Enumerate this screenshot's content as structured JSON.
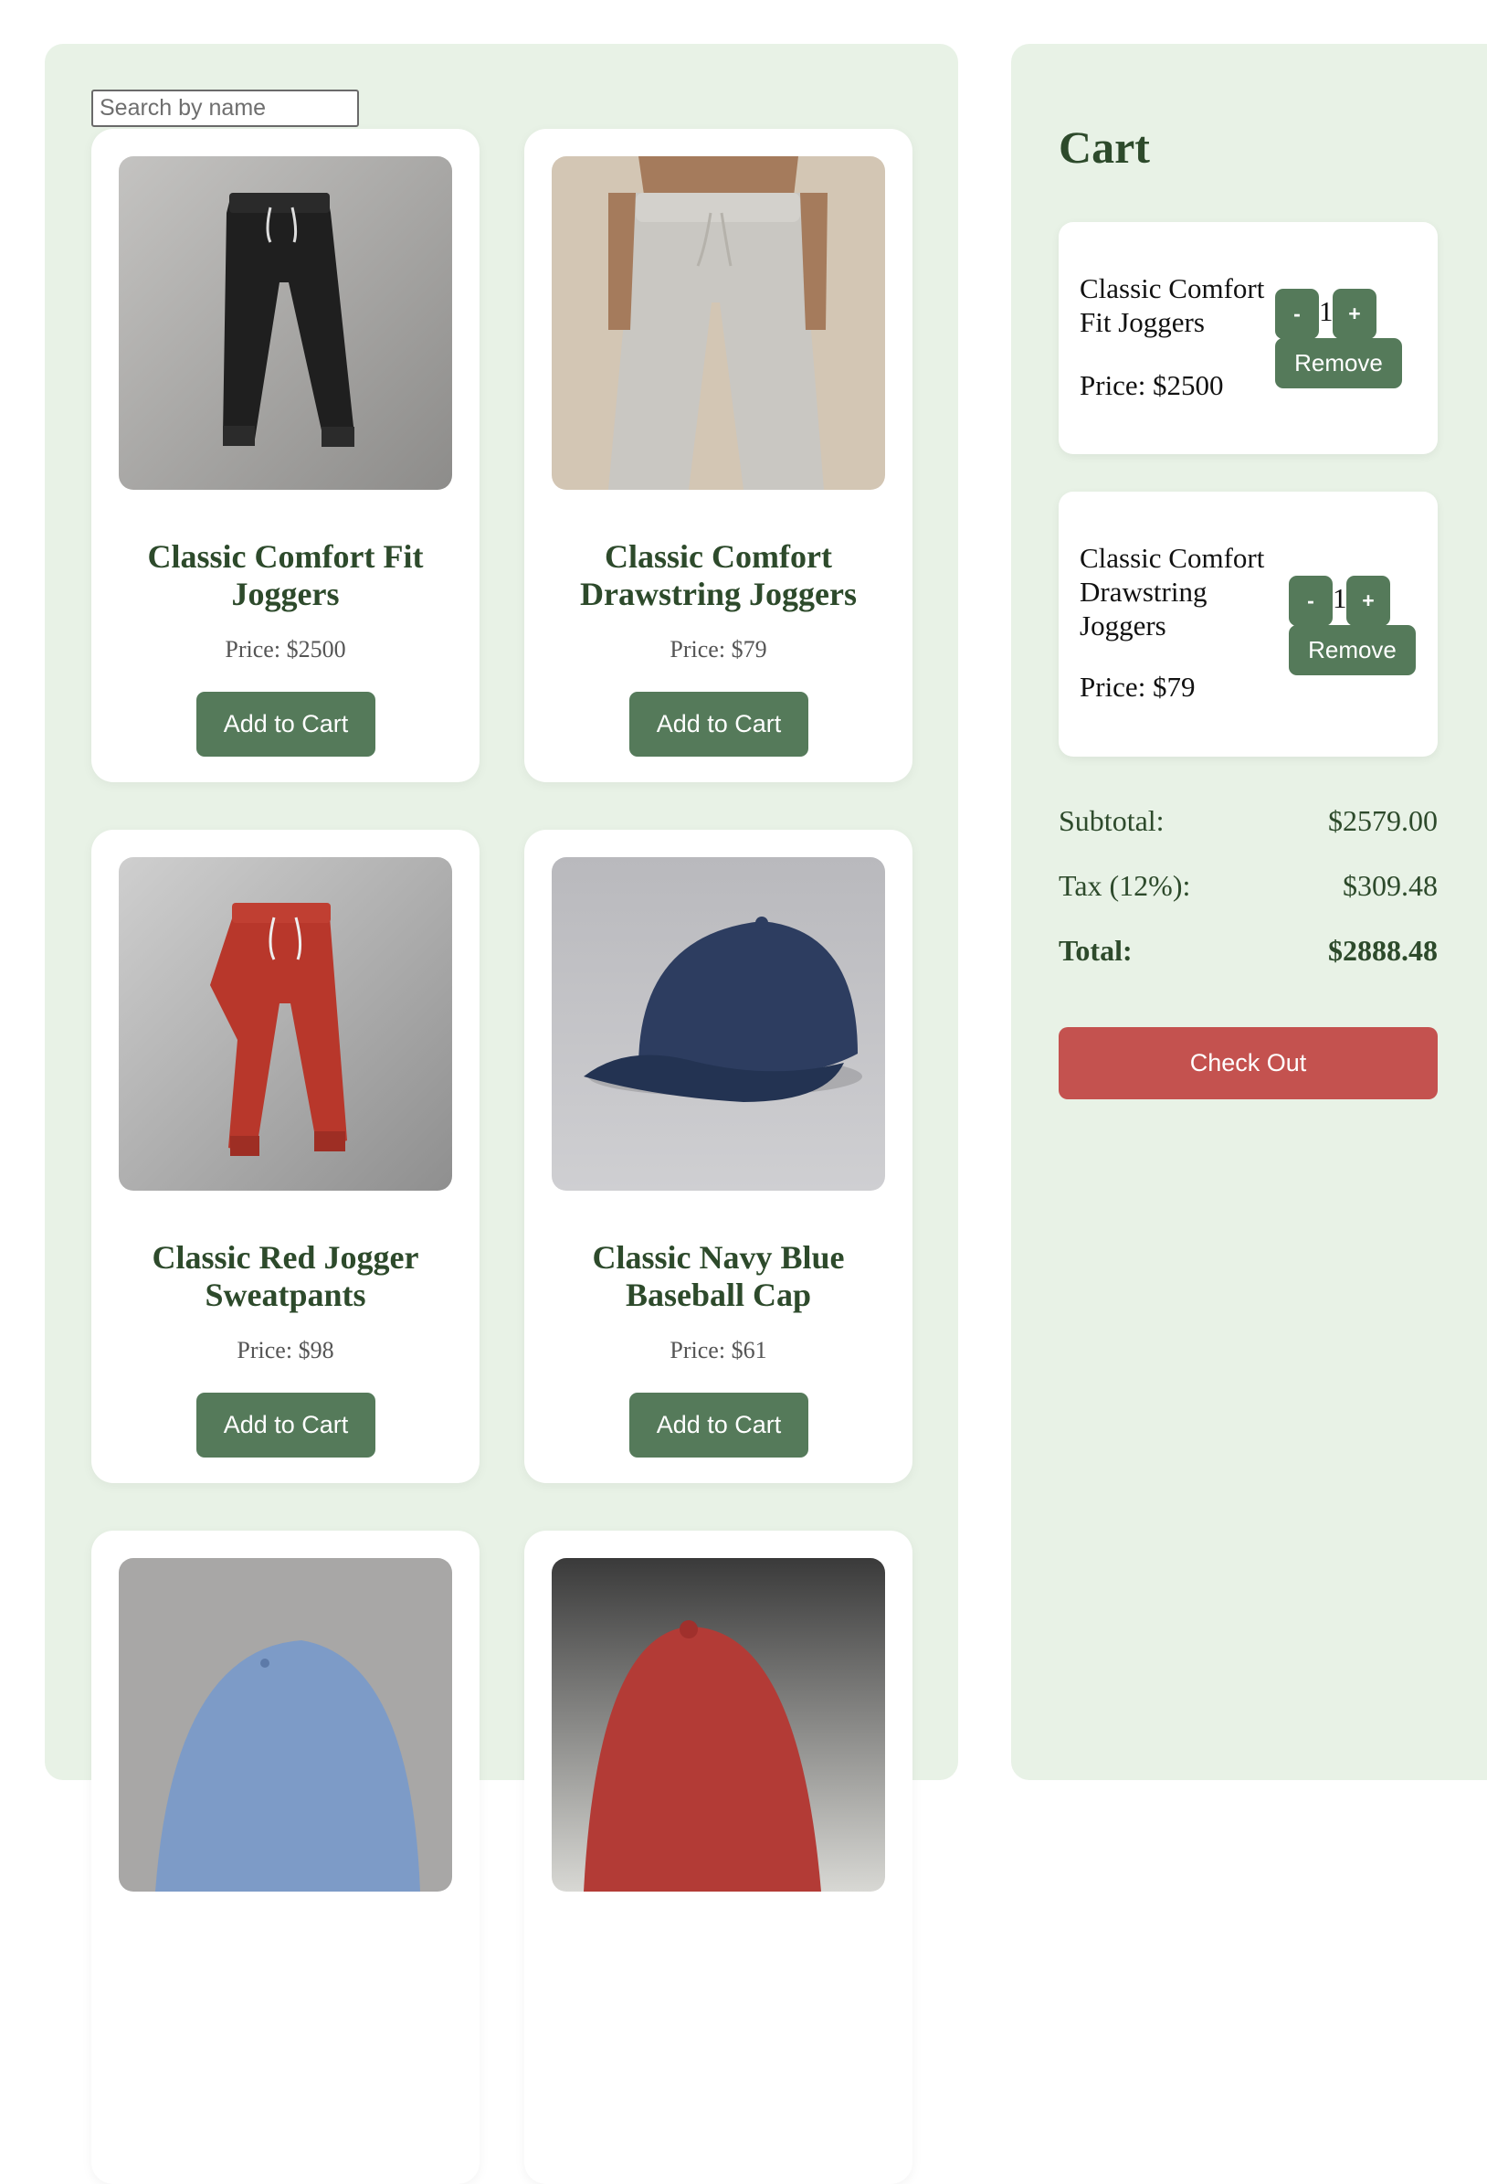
{
  "search": {
    "placeholder": "Search by name"
  },
  "products": [
    {
      "title": "Classic Comfort Fit Joggers",
      "price": "Price: $2500",
      "button": "Add to Cart",
      "image": "black-jogger-pants"
    },
    {
      "title": "Classic Comfort Drawstring Joggers",
      "price": "Price: $79",
      "button": "Add to Cart",
      "image": "gray-drawstring-joggers"
    },
    {
      "title": "Classic Red Jogger Sweatpants",
      "price": "Price: $98",
      "button": "Add to Cart",
      "image": "red-jogger-sweatpants"
    },
    {
      "title": "Classic Navy Blue Baseball Cap",
      "price": "Price: $61",
      "button": "Add to Cart",
      "image": "navy-baseball-cap"
    },
    {
      "image": "light-blue-baseball-cap"
    },
    {
      "image": "red-baseball-cap"
    }
  ],
  "cart": {
    "heading": "Cart",
    "items": [
      {
        "name": "Classic Comfort Fit Joggers",
        "price": "Price: $2500",
        "quantity": "1",
        "minus": "-",
        "plus": "+",
        "remove": "Remove"
      },
      {
        "name": "Classic Comfort Drawstring Joggers",
        "price": "Price: $79",
        "quantity": "1",
        "minus": "-",
        "plus": "+",
        "remove": "Remove"
      }
    ],
    "summary": {
      "subtotal_label": "Subtotal:",
      "subtotal_value": "$2579.00",
      "tax_label": "Tax (12%):",
      "tax_value": "$309.48",
      "total_label": "Total:",
      "total_value": "$2888.48"
    },
    "checkout": "Check Out"
  },
  "colors": {
    "panel_bg": "#e8f2e6",
    "accent_green": "#557a5a",
    "title_green": "#2d4a2b",
    "checkout_red": "#c4524f"
  }
}
